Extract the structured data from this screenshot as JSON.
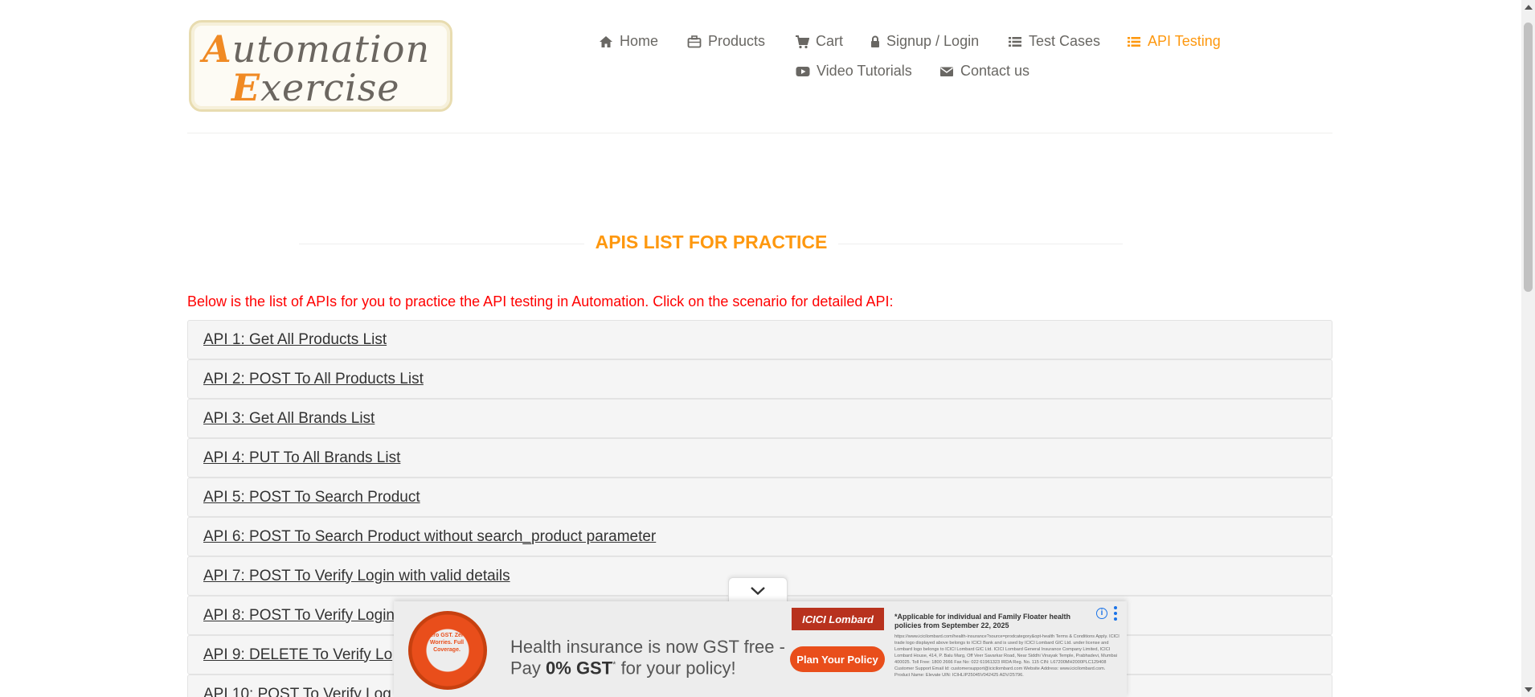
{
  "logo": {
    "line1_cap": "A",
    "line1_rest": "utomation",
    "line2_cap": "E",
    "line2_rest": "xercise"
  },
  "nav": {
    "items": [
      {
        "label": "Home",
        "icon": "home-icon"
      },
      {
        "label": "Products",
        "icon": "briefcase-icon"
      },
      {
        "label": "Cart",
        "icon": "cart-icon"
      },
      {
        "label": "Signup / Login",
        "icon": "lock-icon"
      },
      {
        "label": "Test Cases",
        "icon": "list-icon"
      },
      {
        "label": "API Testing",
        "icon": "list-icon",
        "active": true
      },
      {
        "label": "Video Tutorials",
        "icon": "youtube-icon"
      },
      {
        "label": "Contact us",
        "icon": "envelope-icon"
      }
    ]
  },
  "section": {
    "title": "APIS LIST FOR PRACTICE",
    "intro": "Below is the list of APIs for you to practice the API testing in Automation. Click on the scenario for detailed API:"
  },
  "apis": [
    "API 1: Get All Products List",
    "API 2: POST To All Products List",
    "API 3: Get All Brands List",
    "API 4: PUT To All Brands List",
    "API 5: POST To Search Product",
    "API 6: POST To Search Product without search_product parameter",
    "API 7: POST To Verify Login with valid details",
    "API 8: POST To Verify Login",
    "API 9: DELETE To Verify Lo",
    "API 10: POST To Verify Log"
  ],
  "ad": {
    "buoy_text": "Zero GST. Zero Worries. Full Coverage.",
    "headline_line1": "Health insurance is now GST free -",
    "headline_pay": "Pay ",
    "headline_bold": "0% GST",
    "headline_star": "*",
    "headline_rest": " for your policy!",
    "brand": "ICICI Lombard",
    "cta": "Plan Your Policy",
    "legal_head": "*Applicable for individual and Family Floater health policies from September 22, 2025",
    "legal_body": "https://www.icicilombard.com/health-insurance?source=prodcategory&opt-health Terms & Conditions Apply. ICICI trade logo displayed above belongs to ICICI Bank and is used by ICICI Lombard GIC Ltd. under license and Lombard logo belongs to ICICI Lombard GIC Ltd. ICICI Lombard General Insurance Company Limited, ICICI Lombard House, 414, P. Balu Marg, Off Veer Savarkar Road, Near Siddhi Vinayak Temple, Prabhadevi, Mumbai 400025. Toll Free: 1800 2666 Fax No: 022 61961323 IRDA Reg. No. 115 CIN: L67200MH2000PLC129408 Customer Support Email Id: customersupport@icicilombard.com Website Address: www.icicilombard.com. Product Name: Elevate UIN: ICIHLIP25045V042425 ADV/25796.",
    "info": "i"
  }
}
